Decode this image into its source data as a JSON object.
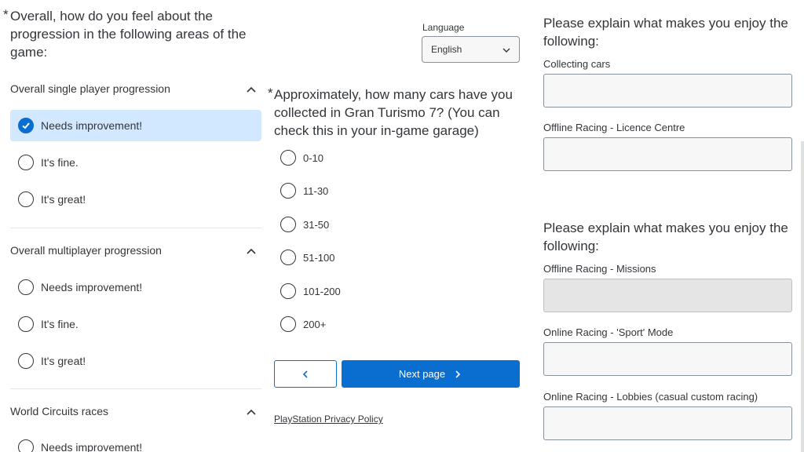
{
  "left": {
    "question": "Overall, how do you feel about the progression in the following areas of the game:",
    "required_mark": "*",
    "sections": [
      {
        "title": "Overall single player progression",
        "options": [
          {
            "label": "Needs improvement!",
            "selected": true
          },
          {
            "label": "It's fine.",
            "selected": false
          },
          {
            "label": "It's great!",
            "selected": false
          }
        ]
      },
      {
        "title": "Overall multiplayer progression",
        "options": [
          {
            "label": "Needs improvement!",
            "selected": false
          },
          {
            "label": "It's fine.",
            "selected": false
          },
          {
            "label": "It's great!",
            "selected": false
          }
        ]
      },
      {
        "title": "World Circuits races",
        "options": [
          {
            "label": "Needs improvement!",
            "selected": false
          }
        ]
      }
    ]
  },
  "middle": {
    "language_label": "Language",
    "language_value": "English",
    "question": "Approximately, how many cars have you collected in Gran Turismo 7? (You can check this in your in-game garage)",
    "required_mark": "*",
    "options": [
      "0-10",
      "11-30",
      "31-50",
      "51-100",
      "101-200",
      "200+"
    ],
    "back_label": "<",
    "next_label": "Next page",
    "privacy_link": "PlayStation Privacy Policy"
  },
  "right": {
    "group1_title": "Please explain what makes you enjoy the following:",
    "group1_fields": [
      "Collecting cars",
      "Offline Racing - Licence Centre"
    ],
    "group2_title": "Please explain what makes you enjoy the following:",
    "group2_fields": [
      "Offline Racing - Missions",
      "Online Racing - 'Sport' Mode",
      "Online Racing - Lobbies (casual custom racing)"
    ]
  },
  "colors": {
    "accent": "#0a6ed1",
    "selected_bg": "#d1e8ff",
    "text": "#32363a",
    "input_bg": "#f7f7f7"
  }
}
